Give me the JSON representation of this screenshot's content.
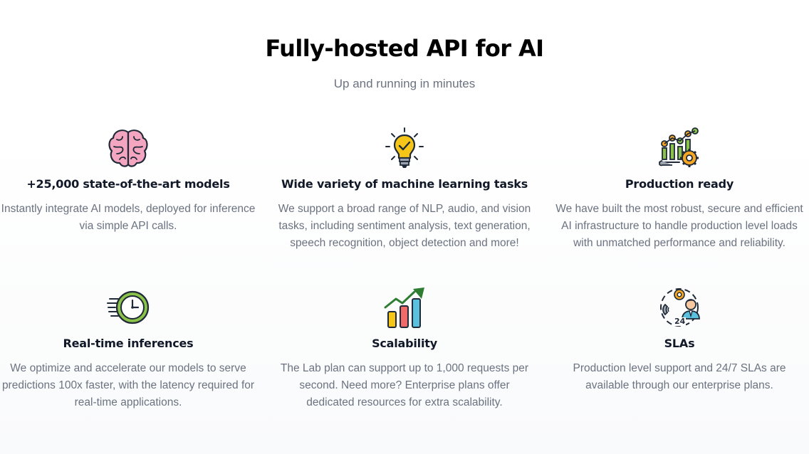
{
  "header": {
    "title": "Fully-hosted API for AI",
    "subtitle": "Up and running in minutes"
  },
  "features": [
    {
      "icon": "brain-icon",
      "title": "+25,000 state-of-the-art models",
      "description": "Instantly integrate AI models, deployed for inference via simple API calls."
    },
    {
      "icon": "lightbulb-icon",
      "title": "Wide variety of machine learning tasks",
      "description": "We support a broad range of NLP, audio, and vision tasks, including sentiment analysis, text generation, speech recognition, object detection and more!"
    },
    {
      "icon": "chart-gear-icon",
      "title": "Production ready",
      "description": "We have built the most robust, secure and efficient AI infrastructure to handle production level loads with unmatched performance and reliability."
    },
    {
      "icon": "clock-icon",
      "title": "Real-time inferences",
      "description": "We optimize and accelerate our models to serve predictions 100x faster, with the latency required for real-time applications."
    },
    {
      "icon": "growth-chart-icon",
      "title": "Scalability",
      "description": "The Lab plan can support up to 1,000 requests per second. Need more? Enterprise plans offer dedicated resources for extra scalability."
    },
    {
      "icon": "support-agent-icon",
      "title": "SLAs",
      "description": "Production level support and 24/7 SLAs are available through our enterprise plans.",
      "icon_text": "24"
    }
  ],
  "colors": {
    "heading": "#000000",
    "body_text": "#6b7280",
    "brain_pink": "#f4a6c0",
    "bulb_yellow": "#f5c518",
    "chart_green": "#8bc34a",
    "gear_orange": "#f5a623",
    "bar_red": "#f06a6a",
    "bar_blue": "#5bc0de"
  }
}
